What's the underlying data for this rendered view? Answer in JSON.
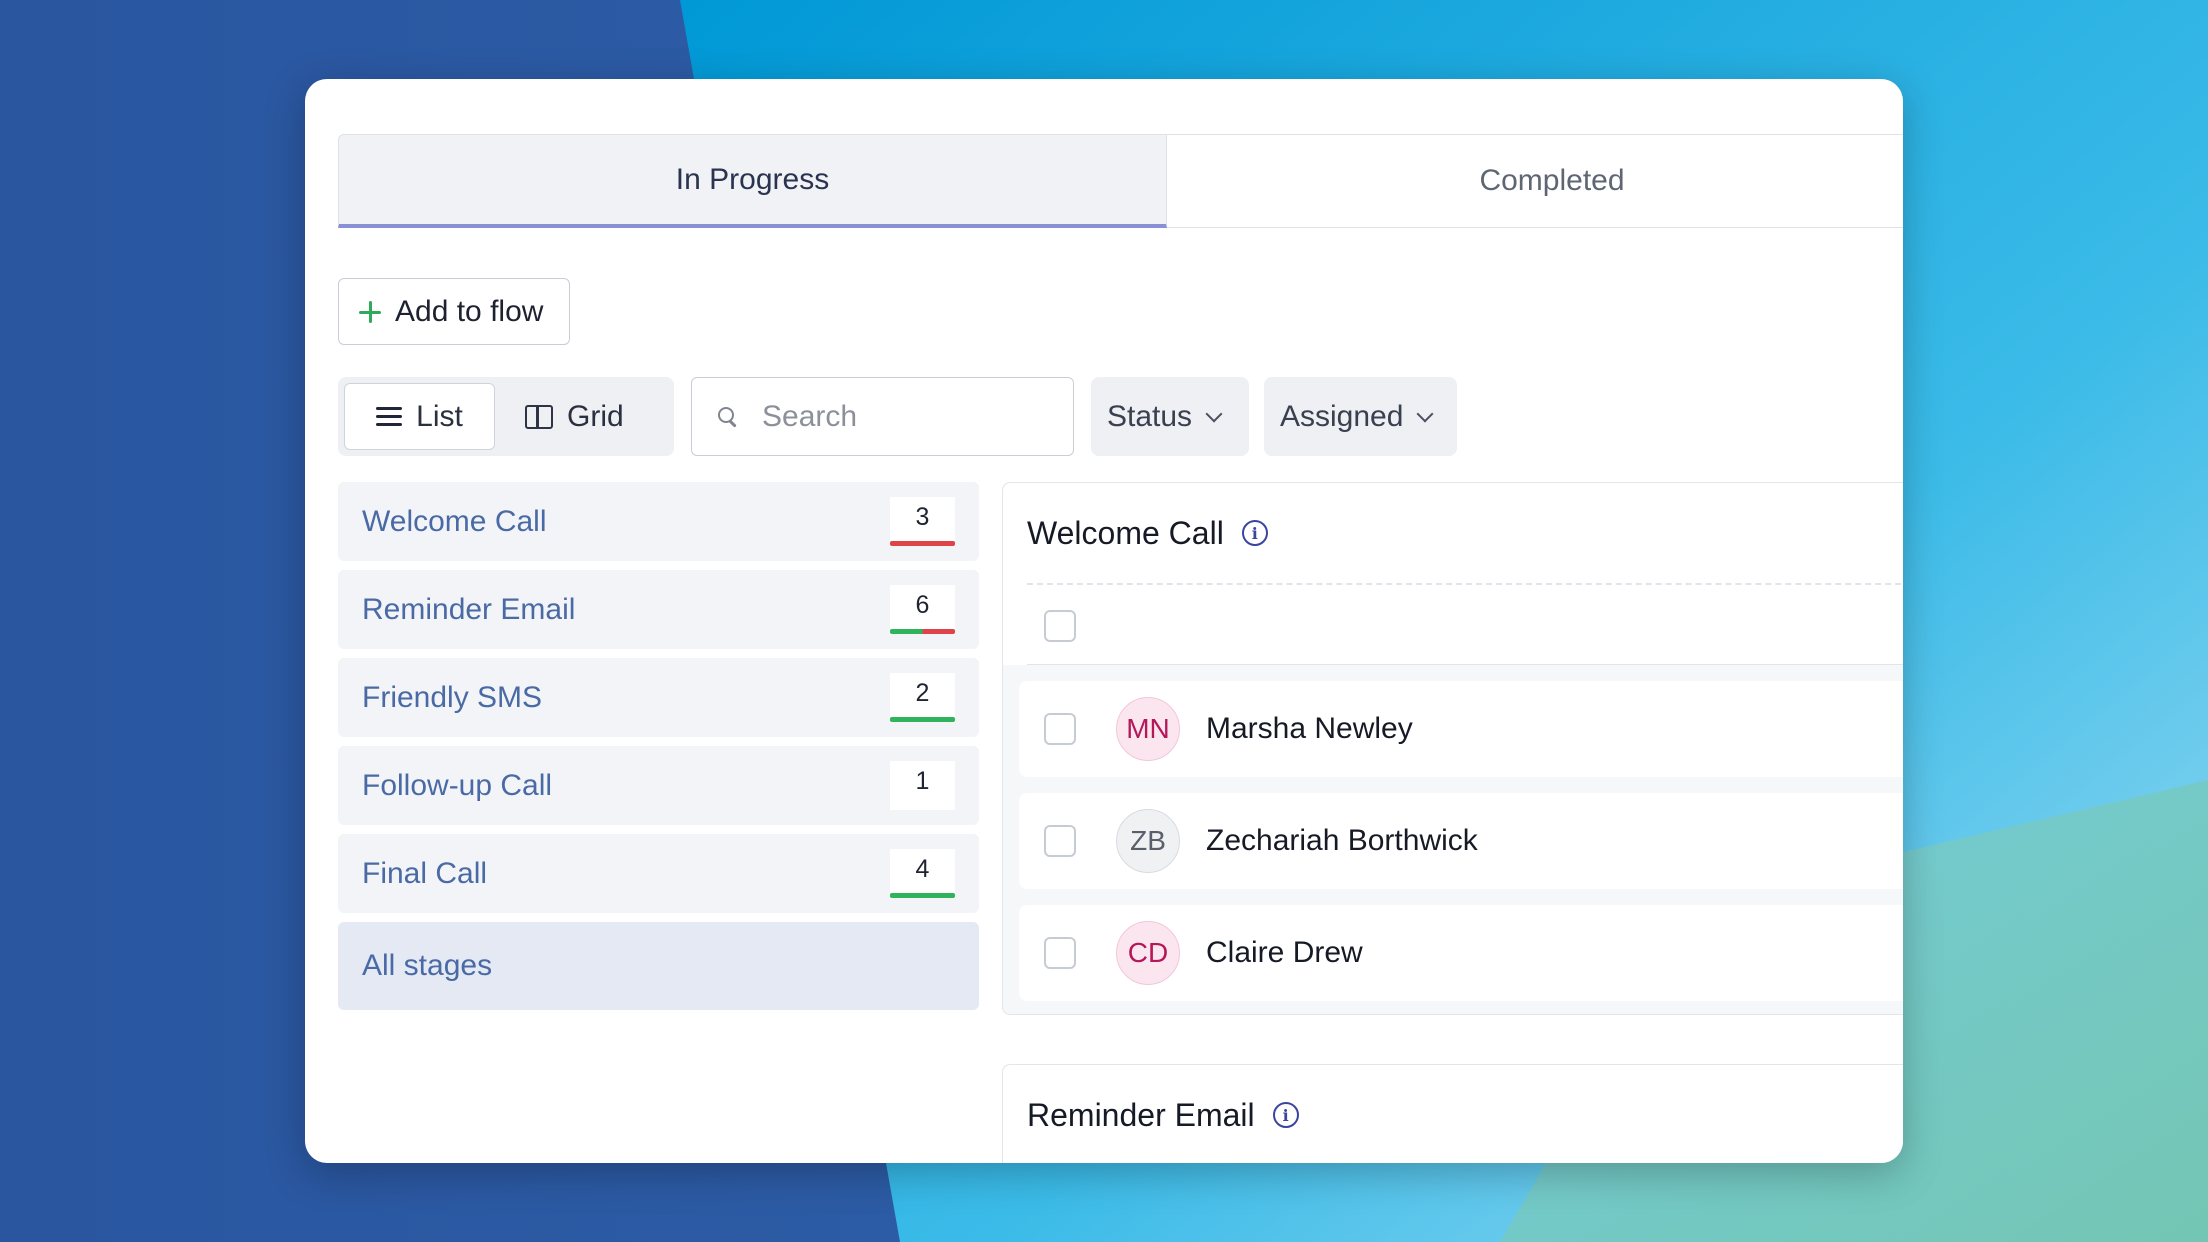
{
  "colors": {
    "red": "#e0424a",
    "green": "#2fb35c",
    "accent": "#8a90d6",
    "stage_text": "#4a6aa5"
  },
  "tabs": [
    {
      "label": "In Progress",
      "active": true
    },
    {
      "label": "Completed",
      "active": false
    }
  ],
  "toolbar": {
    "add_label": "Add to flow",
    "view_list_label": "List",
    "view_grid_label": "Grid",
    "search_placeholder": "Search",
    "status_label": "Status",
    "assigned_label": "Assigned"
  },
  "stages": [
    {
      "label": "Welcome Call",
      "count": "3",
      "bar": "red"
    },
    {
      "label": "Reminder Email",
      "count": "6",
      "bar": "green-red"
    },
    {
      "label": "Friendly SMS",
      "count": "2",
      "bar": "green"
    },
    {
      "label": "Follow-up Call",
      "count": "1",
      "bar": "none"
    },
    {
      "label": "Final Call",
      "count": "4",
      "bar": "green"
    }
  ],
  "all_stages_label": "All stages",
  "panels": [
    {
      "title": "Welcome Call",
      "contacts": [
        {
          "initials": "MN",
          "name": "Marsha Newley",
          "avatar_style": "pink"
        },
        {
          "initials": "ZB",
          "name": "Zechariah Borthwick",
          "avatar_style": "gray"
        },
        {
          "initials": "CD",
          "name": "Claire Drew",
          "avatar_style": "pink"
        }
      ]
    },
    {
      "title": "Reminder Email"
    }
  ]
}
